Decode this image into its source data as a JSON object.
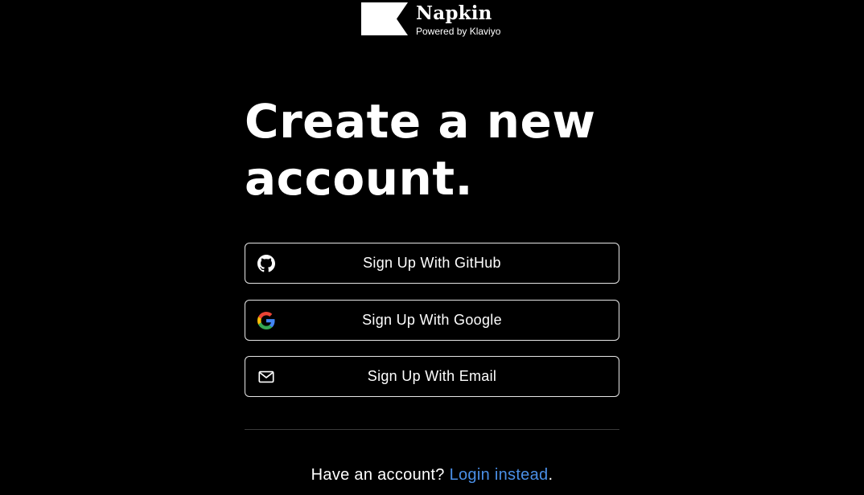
{
  "brand": {
    "name": "Napkin",
    "subtitle": "Powered by Klaviyo",
    "logo_icon": "napkin-flag-logo"
  },
  "heading": {
    "line1": "Create a new",
    "line2": "account."
  },
  "buttons": {
    "github": {
      "label": "Sign Up With GitHub",
      "icon": "github-icon"
    },
    "google": {
      "label": "Sign Up With Google",
      "icon": "google-icon"
    },
    "email": {
      "label": "Sign Up With Email",
      "icon": "mail-icon"
    }
  },
  "footer": {
    "prompt": "Have an account? ",
    "link_label": "Login instead",
    "suffix": "."
  },
  "colors": {
    "background": "#000000",
    "text": "#ffffff",
    "link": "#4a8fe7",
    "button_border": "#e6e6e6",
    "divider": "#3a3a3a"
  }
}
